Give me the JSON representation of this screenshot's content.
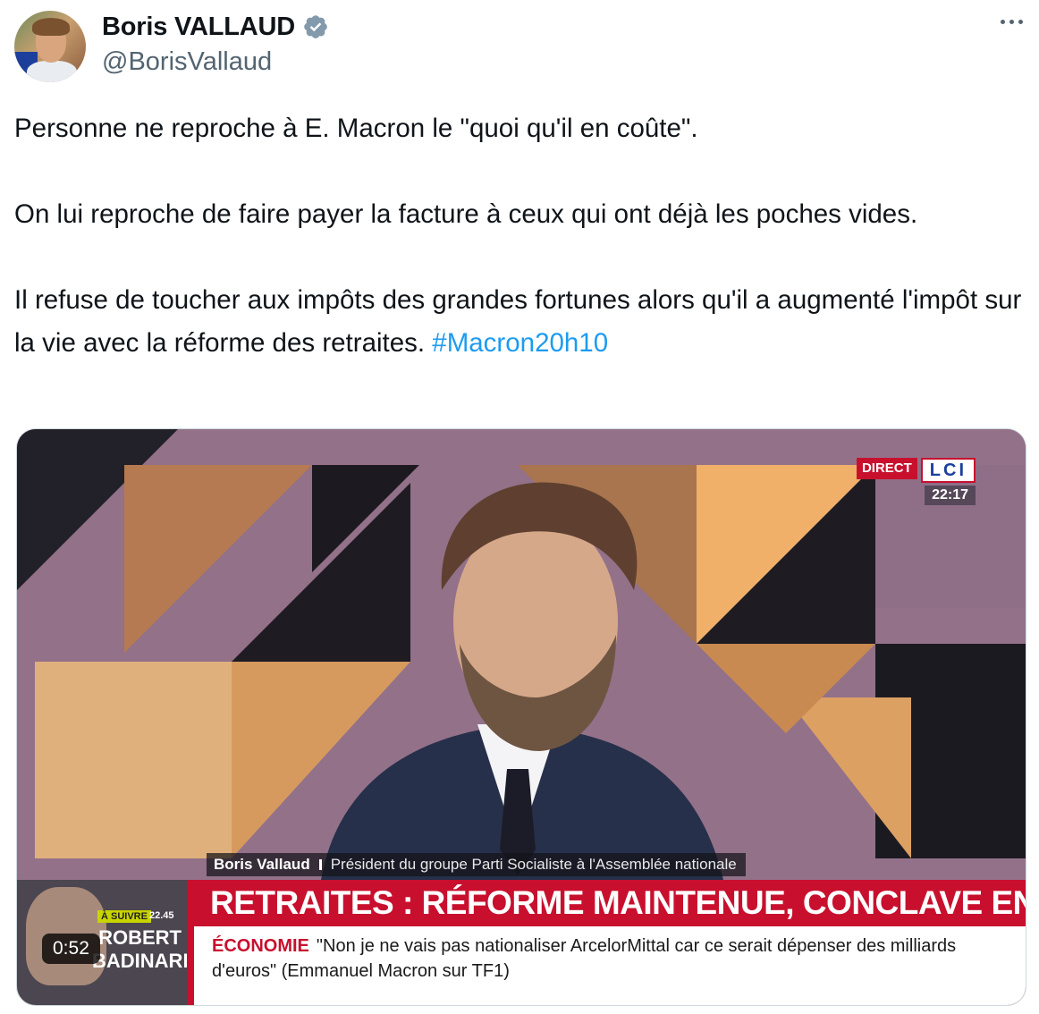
{
  "author": {
    "display_name": "Boris VALLAUD",
    "handle": "@BorisVallaud",
    "verified": true
  },
  "tweet": {
    "paragraphs": [
      "Personne ne reproche à E. Macron le \"quoi qu'il en coûte\".",
      "On lui reproche de faire payer la facture à ceux qui ont déjà les poches vides.",
      "Il refuse de toucher aux impôts des grandes fortunes alors qu'il a augmenté l'impôt sur la vie avec la réforme des retraites."
    ],
    "hashtag": "#Macron20h10"
  },
  "video": {
    "duration": "0:52",
    "live_label": "DIRECT",
    "channel": "LCI",
    "clock": "22:17",
    "guest_name": "Boris Vallaud",
    "guest_role": "Président du groupe Parti Socialiste à l'Assemblée nationale",
    "headline": "RETRAITES : RÉFORME MAINTENUE, CONCLAVE ENTERRÉ",
    "ticker_label": "ÉCONOMIE",
    "ticker_text": "\"Non je ne vais pas nationaliser ArcelorMittal car ce serait dépenser des milliards d'euros\" (Emmanuel Macron sur TF1)",
    "up_next_badge": "À SUIVRE",
    "up_next_time": "22.45",
    "up_next_name": "ROBERT\nBADINARD"
  },
  "icons": {
    "more": "more-horizontal-icon",
    "verified": "verified-badge-icon"
  },
  "colors": {
    "link": "#1d9bf0",
    "verified": "#829aab",
    "secondary_text": "#536471",
    "lci_red": "#c8102e"
  }
}
